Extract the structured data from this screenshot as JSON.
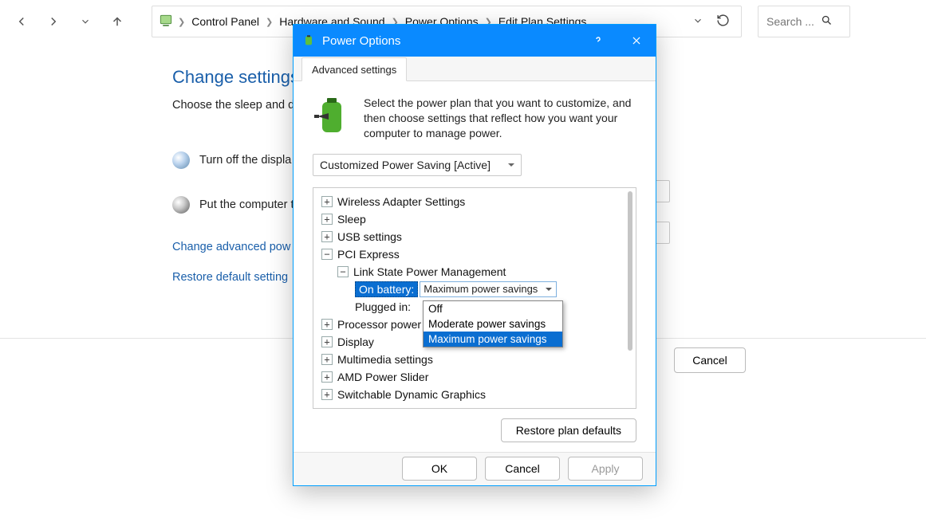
{
  "nav": {
    "breadcrumbs": [
      "Control Panel",
      "Hardware and Sound",
      "Power Options",
      "Edit Plan Settings"
    ]
  },
  "search": {
    "placeholder": "Search ..."
  },
  "cp": {
    "title": "Change settings f",
    "subtitle": "Choose the sleep and d",
    "row1": "Turn off the displa",
    "row2": "Put the computer t",
    "link1": "Change advanced pow",
    "link2": "Restore default setting",
    "cancel": "Cancel"
  },
  "dialog": {
    "title": "Power Options",
    "tab": "Advanced settings",
    "intro": "Select the power plan that you want to customize, and then choose settings that reflect how you want your computer to manage power.",
    "plan": "Customized Power Saving [Active]",
    "tree": {
      "wireless": "Wireless Adapter Settings",
      "sleep": "Sleep",
      "usb": "USB settings",
      "pci": "PCI Express",
      "link_state": "Link State Power Management",
      "on_battery_label": "On battery:",
      "on_battery_value": "Maximum power savings",
      "plugged_in_label": "Plugged in:",
      "processor": "Processor power m",
      "display": "Display",
      "multimedia": "Multimedia settings",
      "amd": "AMD Power Slider",
      "switchable": "Switchable Dynamic Graphics"
    },
    "dropdown": {
      "options": [
        "Off",
        "Moderate power savings",
        "Maximum power savings"
      ],
      "selected_index": 2
    },
    "restore": "Restore plan defaults",
    "buttons": {
      "ok": "OK",
      "cancel": "Cancel",
      "apply": "Apply"
    }
  }
}
